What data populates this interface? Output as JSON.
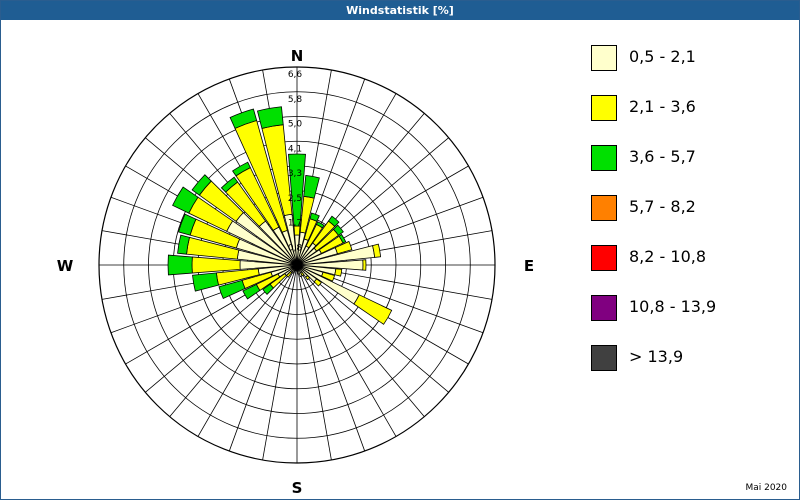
{
  "window": {
    "title": "Windstatistik [%]",
    "footer": "Mai 2020"
  },
  "chart_data": {
    "type": "wind-rose",
    "title": "Windstatistik [%]",
    "unit": "%",
    "radial_ticks": [
      "0,8",
      "1,7",
      "2,5",
      "3,3",
      "4,1",
      "5,0",
      "5,8",
      "6,6"
    ],
    "radial_max": 6.6,
    "sector_count": 36,
    "directions_deg": [
      0,
      10,
      20,
      30,
      40,
      50,
      60,
      70,
      80,
      90,
      100,
      110,
      120,
      130,
      140,
      150,
      160,
      170,
      180,
      190,
      200,
      210,
      220,
      230,
      240,
      250,
      260,
      270,
      280,
      290,
      300,
      310,
      320,
      330,
      340,
      350
    ],
    "cardinal_labels": {
      "N": "N",
      "E": "E",
      "S": "S",
      "W": "W"
    },
    "series": [
      {
        "name": "0,5 - 2,1",
        "color": "#ffffcc",
        "values": [
          1.0,
          1.1,
          0.9,
          0.7,
          0.9,
          0.8,
          0.9,
          1.4,
          2.6,
          2.2,
          1.3,
          0.9,
          2.3,
          0.8,
          0.5,
          0.3,
          0.4,
          0.3,
          0.2,
          0.2,
          0.2,
          0.3,
          0.3,
          0.5,
          0.7,
          0.9,
          1.3,
          1.9,
          2.0,
          2.1,
          2.6,
          2.5,
          1.8,
          1.4,
          1.2,
          1.7
        ]
      },
      {
        "name": "2,1 - 3,6",
        "color": "#ffff00",
        "values": [
          0.3,
          1.2,
          0.7,
          0.8,
          0.9,
          0.9,
          0.8,
          0.5,
          0.2,
          0.1,
          0.2,
          0.4,
          1.2,
          0.2,
          0.1,
          0.1,
          0.0,
          0.0,
          0.0,
          0.0,
          0.0,
          0.0,
          0.2,
          0.6,
          0.8,
          1.0,
          1.4,
          1.6,
          1.7,
          1.6,
          1.4,
          1.5,
          1.6,
          2.2,
          3.8,
          3.0
        ]
      },
      {
        "name": "3,6 - 5,7",
        "color": "#00e000",
        "values": [
          2.4,
          0.7,
          0.2,
          0.1,
          0.2,
          0.2,
          0.1,
          0.0,
          0.0,
          0.0,
          0.0,
          0.0,
          0.0,
          0.0,
          0.0,
          0.0,
          0.0,
          0.0,
          0.0,
          0.0,
          0.0,
          0.0,
          0.0,
          0.3,
          0.5,
          0.8,
          0.8,
          0.8,
          0.3,
          0.4,
          0.6,
          0.3,
          0.2,
          0.2,
          0.4,
          0.6
        ]
      },
      {
        "name": "5,7 - 8,2",
        "color": "#ff8000",
        "values": [
          0,
          0,
          0,
          0,
          0,
          0,
          0,
          0,
          0,
          0,
          0,
          0,
          0,
          0,
          0,
          0,
          0,
          0,
          0,
          0,
          0,
          0,
          0,
          0,
          0,
          0,
          0,
          0,
          0,
          0,
          0,
          0,
          0,
          0,
          0,
          0
        ]
      },
      {
        "name": "8,2 - 10,8",
        "color": "#ff0000",
        "values": [
          0,
          0,
          0,
          0,
          0,
          0,
          0,
          0,
          0,
          0,
          0,
          0,
          0,
          0,
          0,
          0,
          0,
          0,
          0,
          0,
          0,
          0,
          0,
          0,
          0,
          0,
          0,
          0,
          0,
          0,
          0,
          0,
          0,
          0,
          0,
          0
        ]
      },
      {
        "name": "10,8 - 13,9",
        "color": "#800080",
        "values": [
          0,
          0,
          0,
          0,
          0,
          0,
          0,
          0,
          0,
          0,
          0,
          0,
          0,
          0,
          0,
          0,
          0,
          0,
          0,
          0,
          0,
          0,
          0,
          0,
          0,
          0,
          0,
          0,
          0,
          0,
          0,
          0,
          0,
          0,
          0,
          0
        ]
      },
      {
        "name": "> 13,9",
        "color": "#404040",
        "values": [
          0,
          0,
          0,
          0,
          0,
          0,
          0,
          0,
          0,
          0,
          0,
          0,
          0,
          0,
          0,
          0,
          0,
          0,
          0,
          0,
          0,
          0,
          0,
          0,
          0,
          0,
          0,
          0,
          0,
          0,
          0,
          0,
          0,
          0,
          0,
          0
        ]
      }
    ],
    "legend_position": "right",
    "grid": true
  },
  "legend": [
    {
      "label": "0,5 - 2,1",
      "color": "#ffffcc"
    },
    {
      "label": "2,1 - 3,6",
      "color": "#ffff00"
    },
    {
      "label": "3,6 - 5,7",
      "color": "#00e000"
    },
    {
      "label": "5,7 - 8,2",
      "color": "#ff8000"
    },
    {
      "label": "8,2 - 10,8",
      "color": "#ff0000"
    },
    {
      "label": "10,8 - 13,9",
      "color": "#800080"
    },
    {
      "label": "> 13,9",
      "color": "#404040"
    }
  ]
}
